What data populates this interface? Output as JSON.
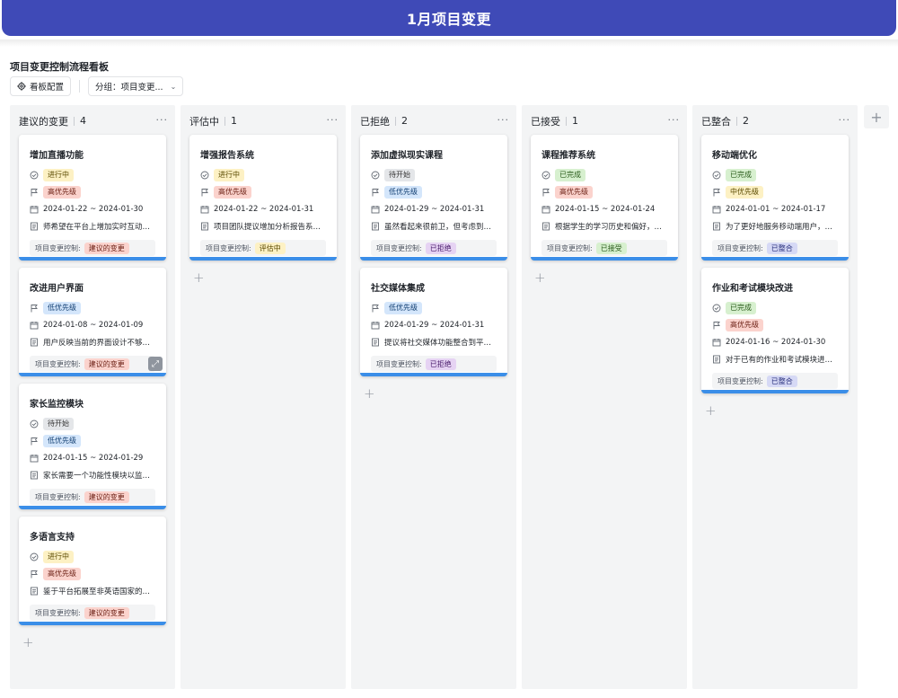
{
  "header": {
    "title": "1月项目变更"
  },
  "board": {
    "title": "项目变更控制流程看板",
    "config_label": "看板配置",
    "group_label": "分组：项目变更..."
  },
  "icons": {
    "status": "check-circle-icon",
    "priority": "flag-icon",
    "date": "calendar-icon",
    "desc": "document-icon",
    "more": "more-icon",
    "add": "plus-icon",
    "config": "gear-icon"
  },
  "ctrl_label": "项目变更控制:",
  "columns": [
    {
      "name": "建议的变更",
      "count": "4",
      "cards": [
        {
          "title": "增加直播功能",
          "status": "进行中",
          "priority": "高优先级",
          "date": "2024-01-22 ~ 2024-01-30",
          "desc": "师希望在平台上增加实时互动直...",
          "ctrl": "建议的变更"
        },
        {
          "title": "改进用户界面",
          "priority": "低优先级",
          "date": "2024-01-08 ~ 2024-01-09",
          "desc": "用户反映当前的界面设计不够直...",
          "ctrl": "建议的变更"
        },
        {
          "title": "家长监控模块",
          "status": "待开始",
          "priority": "低优先级",
          "date": "2024-01-15 ~ 2024-01-29",
          "desc": "家长需要一个功能性模块以监督...",
          "ctrl": "建议的变更"
        },
        {
          "title": "多语言支持",
          "status": "进行中",
          "priority": "高优先级",
          "desc": "鉴于平台拓展至非英语国家的需...",
          "ctrl": "建议的变更"
        }
      ]
    },
    {
      "name": "评估中",
      "count": "1",
      "cards": [
        {
          "title": "增强报告系统",
          "status": "进行中",
          "priority": "高优先级",
          "date": "2024-01-22 ~ 2024-01-31",
          "desc": "项目团队提议增加分析报告系统...",
          "ctrl": "评估中"
        }
      ]
    },
    {
      "name": "已拒绝",
      "count": "2",
      "cards": [
        {
          "title": "添加虚拟现实课程",
          "status": "待开始",
          "priority": "低优先级",
          "date": "2024-01-29 ~ 2024-01-31",
          "desc": "虽然看起来很前卫，但考虑到技...",
          "ctrl": "已拒绝"
        },
        {
          "title": "社交媒体集成",
          "priority": "低优先级",
          "date": "2024-01-29 ~ 2024-01-31",
          "desc": "提议将社交媒体功能整合到平台...",
          "ctrl": "已拒绝"
        }
      ]
    },
    {
      "name": "已接受",
      "count": "1",
      "cards": [
        {
          "title": "课程推荐系统",
          "status": "已完成",
          "priority": "高优先级",
          "date": "2024-01-15 ~ 2024-01-24",
          "desc": "根据学生的学习历史和偏好，推...",
          "ctrl": "已接受"
        }
      ]
    },
    {
      "name": "已整合",
      "count": "2",
      "cards": [
        {
          "title": "移动端优化",
          "status": "已完成",
          "priority": "中优先级",
          "date": "2024-01-01 ~ 2024-01-17",
          "desc": "为了更好地服务移动端用户，此...",
          "ctrl": "已整合"
        },
        {
          "title": "作业和考试模块改进",
          "status": "已完成",
          "priority": "高优先级",
          "date": "2024-01-16 ~ 2024-01-30",
          "desc": "对于已有的作业和考试模块进行...",
          "ctrl": "已整合"
        }
      ]
    }
  ]
}
